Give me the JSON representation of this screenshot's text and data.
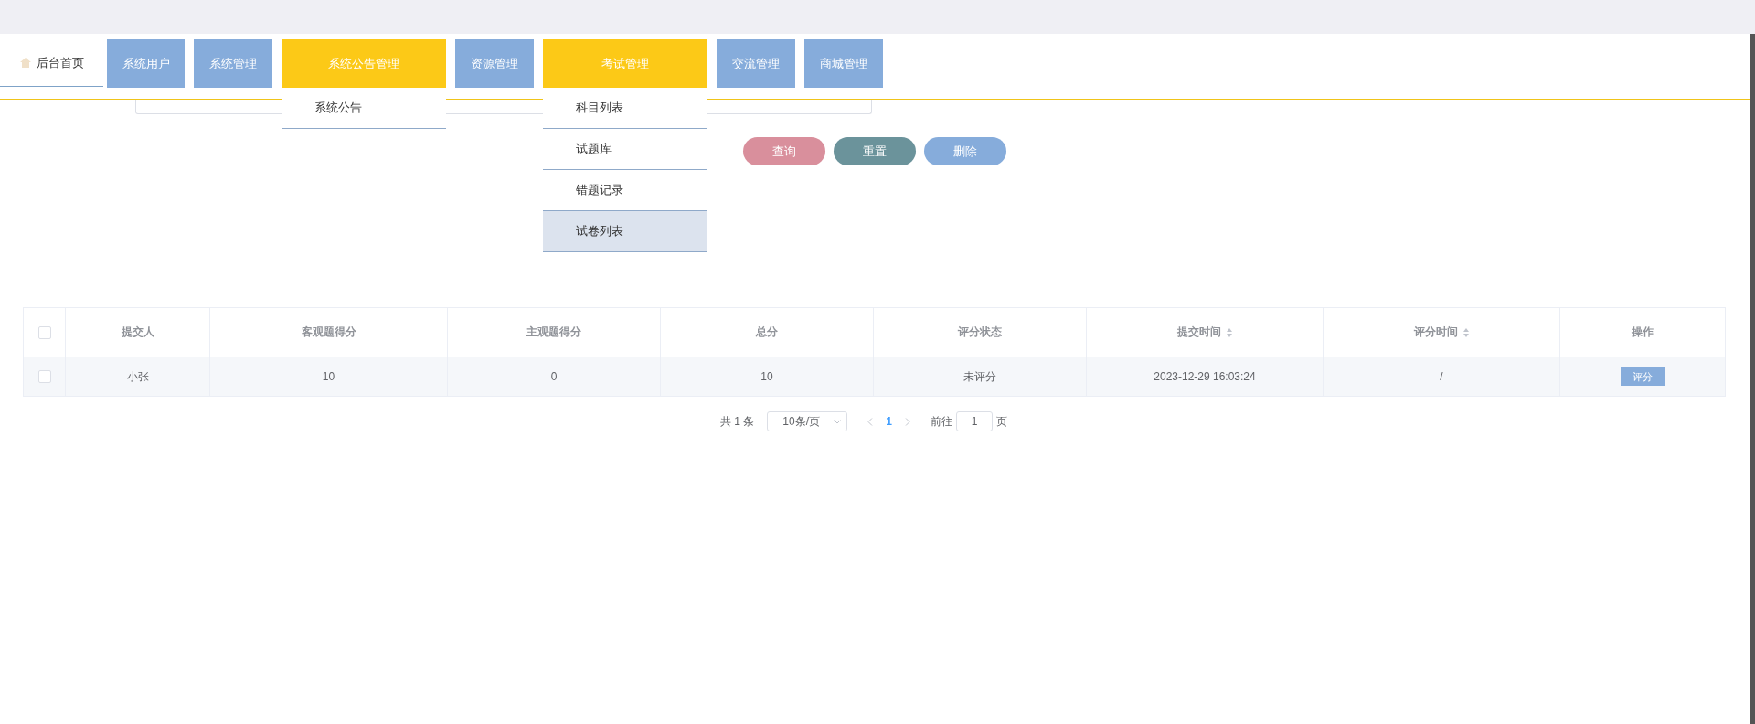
{
  "home_tab": {
    "label": "后台首页"
  },
  "nav": [
    {
      "label": "系统用户",
      "selected": false
    },
    {
      "label": "系统管理",
      "selected": false
    },
    {
      "label": "系统公告管理",
      "selected": true,
      "children": [
        {
          "label": "系统公告",
          "selected": false
        }
      ]
    },
    {
      "label": "资源管理",
      "selected": false
    },
    {
      "label": "考试管理",
      "selected": true,
      "children": [
        {
          "label": "科目列表",
          "selected": false
        },
        {
          "label": "试题库",
          "selected": false
        },
        {
          "label": "错题记录",
          "selected": false
        },
        {
          "label": "试卷列表",
          "selected": true
        }
      ]
    },
    {
      "label": "交流管理",
      "selected": false
    },
    {
      "label": "商城管理",
      "selected": false
    }
  ],
  "actions": [
    {
      "label": "查询",
      "color": "#d98f9c"
    },
    {
      "label": "重置",
      "color": "#6b939b"
    },
    {
      "label": "删除",
      "color": "#86acdb"
    }
  ],
  "table": {
    "select_all": {
      "checked": false
    },
    "columns": [
      {
        "label": "提交人",
        "sortable": false
      },
      {
        "label": "客观题得分",
        "sortable": false
      },
      {
        "label": "主观题得分",
        "sortable": false
      },
      {
        "label": "总分",
        "sortable": false
      },
      {
        "label": "评分状态",
        "sortable": false
      },
      {
        "label": "提交时间",
        "sortable": true
      },
      {
        "label": "评分时间",
        "sortable": true
      },
      {
        "label": "操作",
        "sortable": false
      }
    ],
    "rows": [
      {
        "checked": false,
        "cells": [
          "小张",
          "10",
          "0",
          "10",
          "未评分",
          "2023-12-29 16:03:24",
          "/"
        ],
        "action": "评分"
      }
    ]
  },
  "pagination": {
    "total": "共 1 条",
    "page_size": "10条/页",
    "current": "1",
    "goto_label": "前往",
    "goto_value": "1",
    "page_unit": "页"
  }
}
